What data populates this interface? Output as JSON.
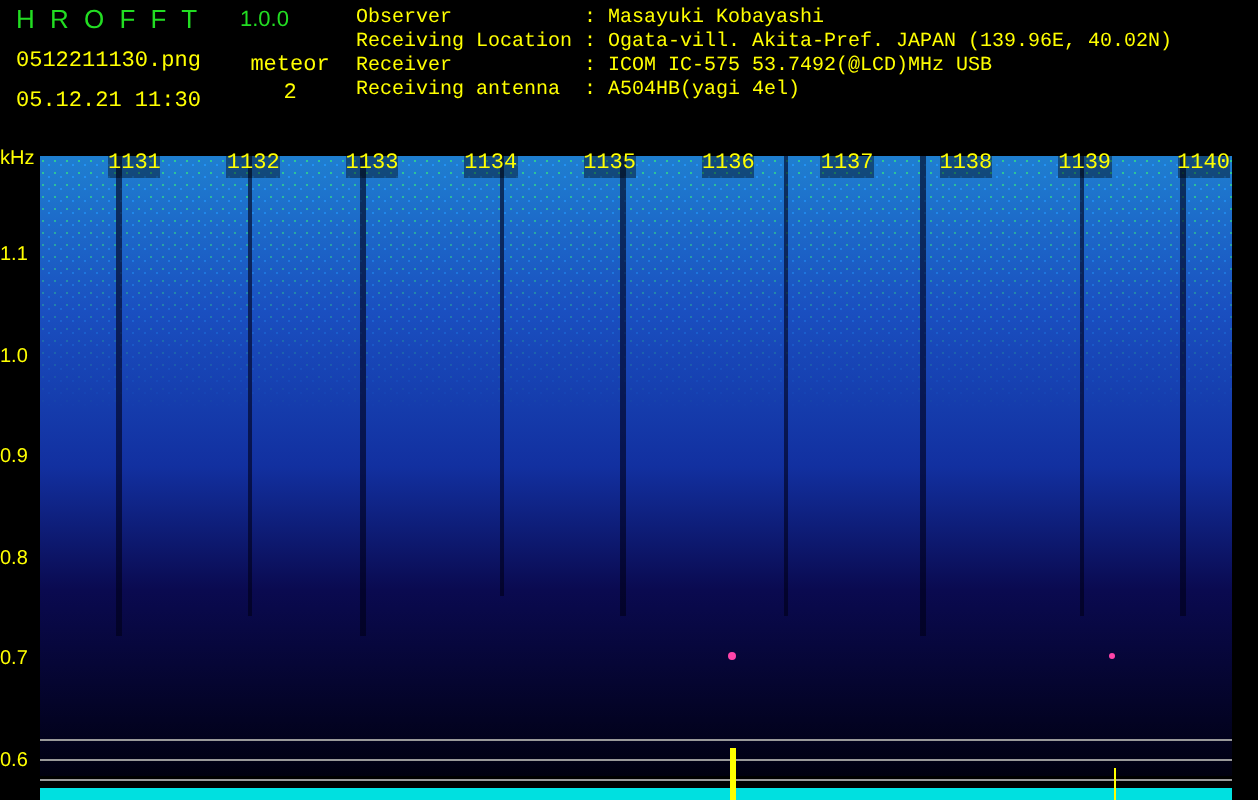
{
  "app": {
    "title": "H R O F F T",
    "version": "1.0.0"
  },
  "file_name": "0512211130.png",
  "date_time": "05.12.21 11:30",
  "meteor": {
    "label": "meteor",
    "count": "2"
  },
  "info": [
    {
      "label": "Observer",
      "separator": ":",
      "value": "Masayuki Kobayashi"
    },
    {
      "label": "Receiving Location",
      "separator": ":",
      "value": "Ogata-vill. Akita-Pref. JAPAN (139.96E, 40.02N)"
    },
    {
      "label": "Receiver",
      "separator": ":",
      "value": "ICOM IC-575 53.7492(@LCD)MHz USB"
    },
    {
      "label": "Receiving antenna",
      "separator": ":",
      "value": "A504HB(yagi 4el)"
    }
  ],
  "plot": {
    "unit": "kHz",
    "y_labels": [
      "1.1",
      "1.0",
      "0.9",
      "0.8",
      "0.7",
      "0.6"
    ],
    "time_labels": [
      "1131",
      "1132",
      "1133",
      "1134",
      "1135",
      "1136",
      "1137",
      "1138",
      "1139",
      "1140"
    ]
  }
}
